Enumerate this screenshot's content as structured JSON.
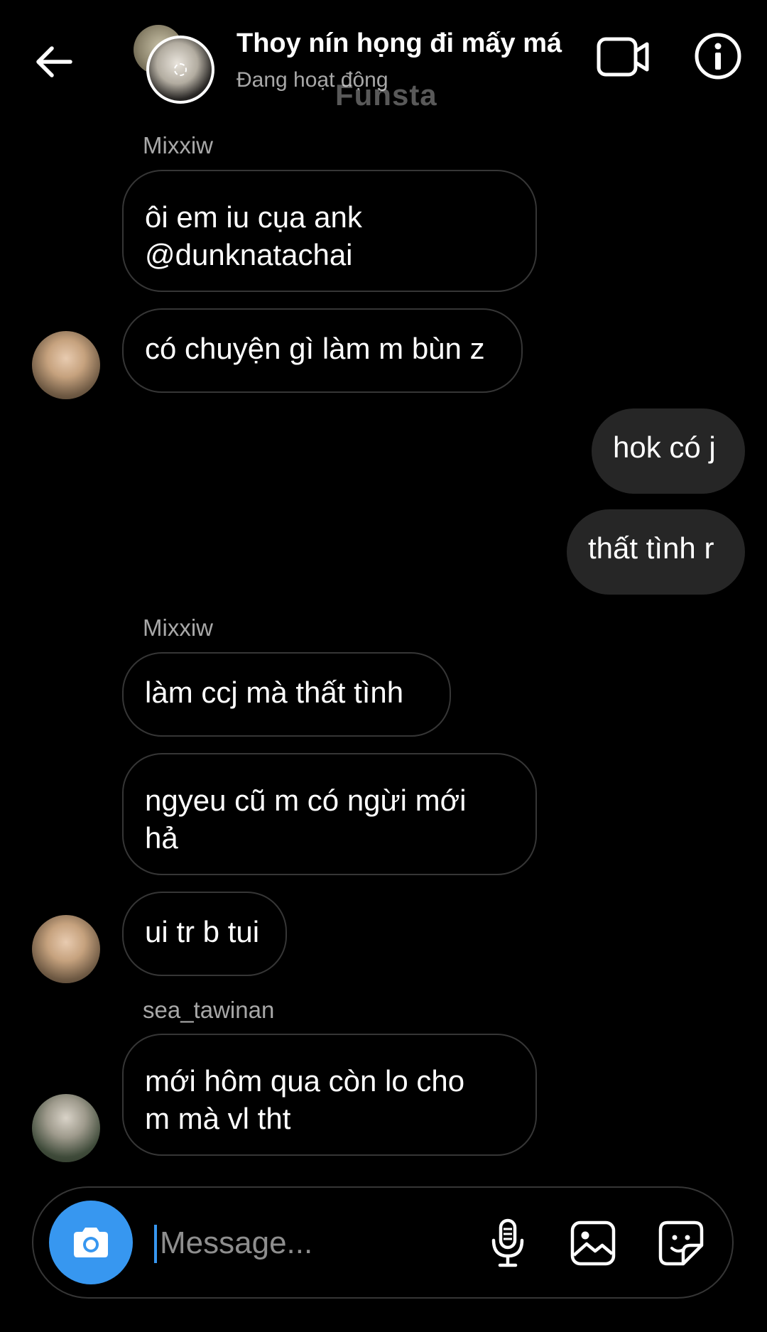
{
  "header": {
    "title": "Thoy nín họng đi mấy má",
    "status": "Đang hoạt động",
    "watermark": "Funsta",
    "icons": [
      "back-arrow-icon",
      "video-call-icon",
      "info-icon"
    ]
  },
  "messages": {
    "m1": {
      "sender": "Mixxiw",
      "lines": [
        "ôi em iu cụa ank",
        "@dunknatachai"
      ]
    },
    "m2": {
      "text": "có chuyện gì làm m bùn z"
    },
    "m3": {
      "text": "hok có j"
    },
    "m4": {
      "text": "thất tình r"
    },
    "m5": {
      "sender": "Mixxiw",
      "text": "làm ccj mà thất tình"
    },
    "m6": {
      "lines": [
        "ngyeu cũ m có ngừi mới",
        "hả"
      ]
    },
    "m7": {
      "text": "ui tr b tui"
    },
    "m8": {
      "sender": "sea_tawinan",
      "lines": [
        "mới hôm qua còn lo cho",
        "m mà vl tht"
      ]
    }
  },
  "composer": {
    "placeholder": "Message...",
    "icons": [
      "camera-icon",
      "microphone-icon",
      "gallery-icon",
      "sticker-icon"
    ]
  },
  "colors": {
    "background": "#000000",
    "accent": "#3797f0",
    "outgoing_bubble": "#262626",
    "incoming_border": "#363636",
    "secondary_text": "#a8a8a8"
  }
}
